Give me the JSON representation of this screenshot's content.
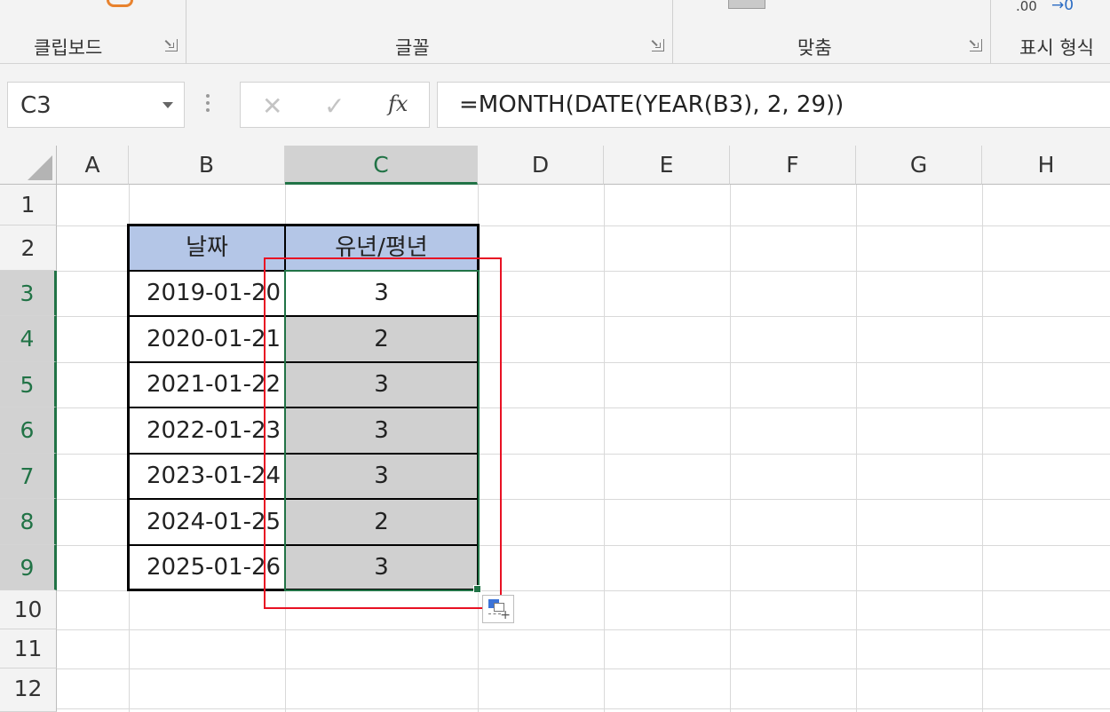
{
  "ribbon": {
    "groups": [
      {
        "label": "클립보드"
      },
      {
        "label": "글꼴"
      },
      {
        "label": "맞춤"
      },
      {
        "label": "표시 형식"
      }
    ],
    "number_format_hint": ".00",
    "number_format_arrow": "→0"
  },
  "formula_bar": {
    "name_box": "C3",
    "cancel_symbol": "✕",
    "enter_symbol": "✓",
    "fx_label": "fx",
    "formula": "=MONTH(DATE(YEAR(B3), 2, 29))"
  },
  "sheet": {
    "columns": [
      "A",
      "B",
      "C",
      "D",
      "E",
      "F",
      "G",
      "H"
    ],
    "rows": [
      "1",
      "2",
      "3",
      "4",
      "5",
      "6",
      "7",
      "8",
      "9",
      "10",
      "11",
      "12"
    ],
    "selected_column": "C",
    "selected_rows": [
      "3",
      "4",
      "5",
      "6",
      "7",
      "8",
      "9"
    ],
    "table": {
      "headers": [
        "날짜",
        "유년/평년"
      ],
      "rows": [
        [
          "2019-01-20",
          "3"
        ],
        [
          "2020-01-21",
          "2"
        ],
        [
          "2021-01-22",
          "3"
        ],
        [
          "2022-01-23",
          "3"
        ],
        [
          "2023-01-24",
          "3"
        ],
        [
          "2024-01-25",
          "2"
        ],
        [
          "2025-01-26",
          "3"
        ]
      ]
    }
  },
  "colors": {
    "accent": "#217346",
    "header_fill": "#b4c6e7",
    "highlight": "#e81123"
  }
}
